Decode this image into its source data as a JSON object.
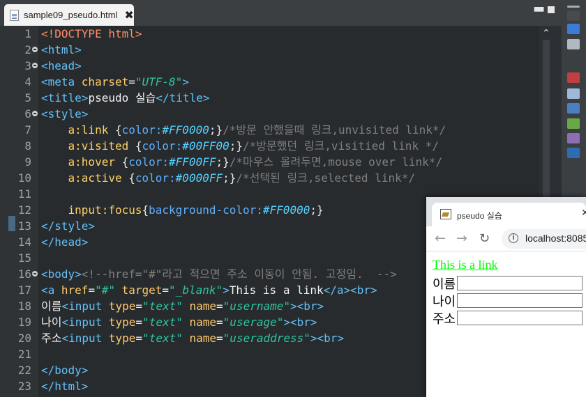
{
  "editor": {
    "tab_title": "sample09_pseudo.html",
    "tab_close": "✖",
    "lines": [
      {
        "n": "1",
        "fold": false,
        "html": [
          [
            "doc",
            "<!DOCTYPE html>"
          ]
        ]
      },
      {
        "n": "2",
        "fold": true,
        "html": [
          [
            "tag",
            "<html>"
          ]
        ]
      },
      {
        "n": "3",
        "fold": true,
        "html": [
          [
            "tag",
            "<head>"
          ]
        ]
      },
      {
        "n": "4",
        "fold": false,
        "html": [
          [
            "tag",
            "<meta "
          ],
          [
            "at",
            "charset"
          ],
          [
            "br",
            "="
          ],
          [
            "av",
            "\"UTF-8\""
          ],
          [
            "tag",
            ">"
          ]
        ]
      },
      {
        "n": "5",
        "fold": false,
        "html": [
          [
            "tag",
            "<title>"
          ],
          [
            "tx",
            "pseudo 실습"
          ],
          [
            "tag",
            "</title>"
          ]
        ]
      },
      {
        "n": "6",
        "fold": true,
        "html": [
          [
            "tag",
            "<style>"
          ]
        ]
      },
      {
        "n": "7",
        "fold": false,
        "html": [
          [
            "tx",
            "    "
          ],
          [
            "sel",
            "a:link "
          ],
          [
            "br",
            "{"
          ],
          [
            "prop",
            "color:"
          ],
          [
            "val",
            "#FF0000"
          ],
          [
            "br",
            ";}"
          ],
          [
            "cm",
            "/*방문 안했을때 링크,unvisited link*/"
          ]
        ]
      },
      {
        "n": "8",
        "fold": false,
        "html": [
          [
            "tx",
            "    "
          ],
          [
            "sel",
            "a:visited "
          ],
          [
            "br",
            "{"
          ],
          [
            "prop",
            "color:"
          ],
          [
            "val",
            "#00FF00"
          ],
          [
            "br",
            ";}"
          ],
          [
            "cm",
            "/*방문했던 링크,visitied link */"
          ]
        ]
      },
      {
        "n": "9",
        "fold": false,
        "html": [
          [
            "tx",
            "    "
          ],
          [
            "sel",
            "a:hover "
          ],
          [
            "br",
            "{"
          ],
          [
            "prop",
            "color:"
          ],
          [
            "val",
            "#FF00FF"
          ],
          [
            "br",
            ";}"
          ],
          [
            "cm",
            "/*마우스 올려두면,mouse over link*/"
          ]
        ]
      },
      {
        "n": "10",
        "fold": false,
        "html": [
          [
            "tx",
            "    "
          ],
          [
            "sel",
            "a:active "
          ],
          [
            "br",
            "{"
          ],
          [
            "prop",
            "color:"
          ],
          [
            "val",
            "#0000FF"
          ],
          [
            "br",
            ";}"
          ],
          [
            "cm",
            "/*선택된 링크,selected link*/"
          ]
        ]
      },
      {
        "n": "11",
        "fold": false,
        "html": []
      },
      {
        "n": "12",
        "fold": false,
        "html": [
          [
            "tx",
            "    "
          ],
          [
            "sel",
            "input:focus"
          ],
          [
            "br",
            "{"
          ],
          [
            "prop",
            "background-color:"
          ],
          [
            "val",
            "#FF0000"
          ],
          [
            "br",
            ";}"
          ]
        ]
      },
      {
        "n": "13",
        "fold": false,
        "html": [
          [
            "tag",
            "</style>"
          ]
        ]
      },
      {
        "n": "14",
        "fold": false,
        "html": [
          [
            "tag",
            "</head>"
          ]
        ]
      },
      {
        "n": "15",
        "fold": false,
        "html": []
      },
      {
        "n": "16",
        "fold": true,
        "html": [
          [
            "tag",
            "<body>"
          ],
          [
            "cm",
            "<!--href=\"#\"라고 적으면 주소 이동이 안됨. 고정임.  -->"
          ]
        ]
      },
      {
        "n": "17",
        "fold": false,
        "html": [
          [
            "tag",
            "<a "
          ],
          [
            "at",
            "href"
          ],
          [
            "br",
            "="
          ],
          [
            "av",
            "\"#\" "
          ],
          [
            "at",
            "target"
          ],
          [
            "br",
            "="
          ],
          [
            "av",
            "\"_blank\""
          ],
          [
            "tag",
            ">"
          ],
          [
            "tx",
            "This is a link"
          ],
          [
            "tag",
            "</a><br>"
          ]
        ]
      },
      {
        "n": "18",
        "fold": false,
        "html": [
          [
            "tx",
            "이름"
          ],
          [
            "tag",
            "<input "
          ],
          [
            "at",
            "type"
          ],
          [
            "br",
            "="
          ],
          [
            "av",
            "\"text\" "
          ],
          [
            "at",
            "name"
          ],
          [
            "br",
            "="
          ],
          [
            "av",
            "\"username\""
          ],
          [
            "tag",
            "><br>"
          ]
        ]
      },
      {
        "n": "19",
        "fold": false,
        "html": [
          [
            "tx",
            "나이"
          ],
          [
            "tag",
            "<input "
          ],
          [
            "at",
            "type"
          ],
          [
            "br",
            "="
          ],
          [
            "av",
            "\"text\" "
          ],
          [
            "at",
            "name"
          ],
          [
            "br",
            "="
          ],
          [
            "av",
            "\"userage\""
          ],
          [
            "tag",
            "><br>"
          ]
        ]
      },
      {
        "n": "20",
        "fold": false,
        "html": [
          [
            "tx",
            "주소"
          ],
          [
            "tag",
            "<input "
          ],
          [
            "at",
            "type"
          ],
          [
            "br",
            "="
          ],
          [
            "av",
            "\"text\" "
          ],
          [
            "at",
            "name"
          ],
          [
            "br",
            "="
          ],
          [
            "av",
            "\"useraddress\""
          ],
          [
            "tag",
            "><br>"
          ]
        ]
      },
      {
        "n": "21",
        "fold": false,
        "html": []
      },
      {
        "n": "22",
        "fold": false,
        "html": [
          [
            "tag",
            "</body>"
          ]
        ]
      },
      {
        "n": "23",
        "fold": false,
        "html": [
          [
            "tag",
            "</html>"
          ]
        ]
      }
    ]
  },
  "browser": {
    "tab_title": "pseudo 실습",
    "url": "localhost:8085",
    "link_text": "This is a link",
    "form": [
      {
        "label": "이름",
        "name": "username"
      },
      {
        "label": "나이",
        "name": "userage"
      },
      {
        "label": "주소",
        "name": "useraddress"
      }
    ]
  },
  "colors": {
    "visited_link": "#00FF00",
    "editor_bg": "#282b2e"
  },
  "icons": [
    "file-icon",
    "close-icon",
    "minimize-icon",
    "maximize-icon",
    "back-arrow-icon",
    "forward-arrow-icon",
    "reload-icon",
    "info-icon",
    "favicon"
  ]
}
